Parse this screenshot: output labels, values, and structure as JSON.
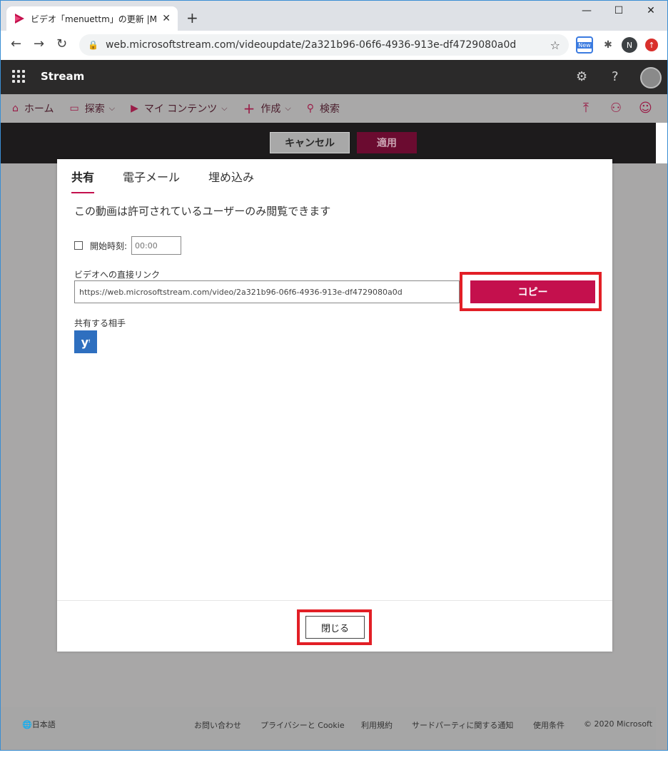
{
  "browser": {
    "tab_title": "ビデオ「menuettm」の更新 |Microsc",
    "tab_close": "✕",
    "new_tab": "+",
    "minimize": "—",
    "maximize": "☐",
    "close": "✕",
    "url": "web.microsoftstream.com/videoupdate/2a321b96-06f6-4936-913e-df4729080a0d",
    "ext_new_label": "New",
    "profile_initial": "N"
  },
  "app": {
    "brand": "Stream",
    "settings_icon": "⚙",
    "help_icon": "?"
  },
  "nav": {
    "items": [
      {
        "icon": "⌂",
        "label": "ホーム",
        "chevron": ""
      },
      {
        "icon": "▭",
        "label": "探索",
        "chevron": "⌵"
      },
      {
        "icon": "▶",
        "label": "マイ コンテンツ",
        "chevron": "⌵"
      },
      {
        "icon": "+",
        "label": "作成",
        "chevron": "⌵"
      },
      {
        "icon": "⚲",
        "label": "検索",
        "chevron": ""
      }
    ],
    "right_icons": [
      "⤒",
      "⚇",
      "☺"
    ]
  },
  "actions": {
    "cancel": "キャンセル",
    "apply": "適用"
  },
  "dialog": {
    "tabs": [
      "共有",
      "電子メール",
      "埋め込み"
    ],
    "info": "この動画は許可されているユーザーのみ閲覧できます",
    "start_label": "開始時刻:",
    "start_placeholder": "00:00",
    "link_label": "ビデオへの直接リンク",
    "link_value": "https://web.microsoftstream.com/video/2a321b96-06f6-4936-913e-df4729080a0d",
    "copy": "コピー",
    "share_label": "共有する相手",
    "yammer_glyph": "y",
    "close": "閉じる"
  },
  "footer": {
    "lang": "🌐日本語",
    "links": [
      "お問い合わせ",
      "プライバシーと Cookie",
      "利用規約",
      "サードパーティに関する通知",
      "使用条件",
      "© 2020 Microsoft"
    ]
  },
  "colors": {
    "accent": "#c4104d",
    "highlight": "#e21f26"
  }
}
